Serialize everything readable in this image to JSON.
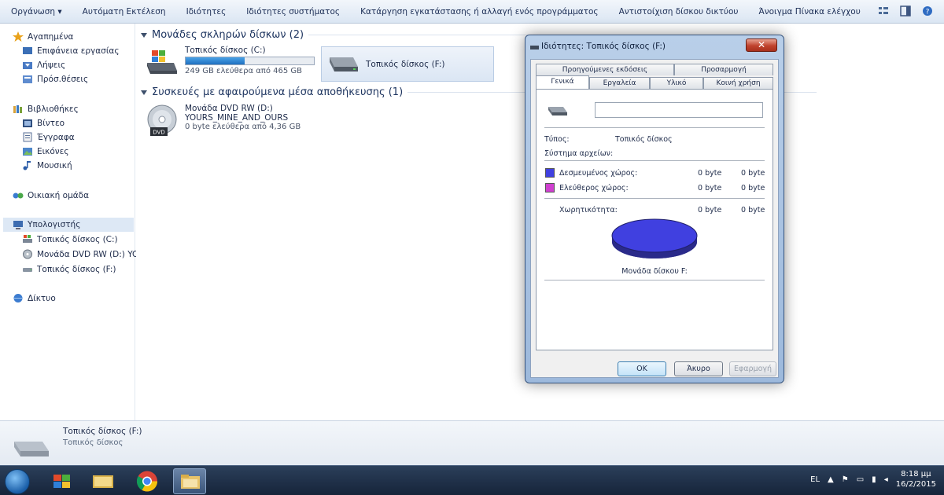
{
  "toolbar": {
    "items": [
      "Οργάνωση ▾",
      "Αυτόματη Εκτέλεση",
      "Ιδιότητες",
      "Ιδιότητες συστήματος",
      "Κατάργηση εγκατάστασης ή αλλαγή ενός προγράμματος",
      "Αντιστοίχιση δίσκου δικτύου",
      "Άνοιγμα Πίνακα ελέγχου"
    ]
  },
  "sidebar": {
    "favorites": "Αγαπημένα",
    "desktop": "Επιφάνεια εργασίας",
    "downloads": "Λήψεις",
    "recent": "Πρόσ.θέσεις",
    "libraries": "Βιβλιοθήκες",
    "video": "Βίντεο",
    "documents": "Έγγραφα",
    "pictures": "Εικόνες",
    "music": "Μουσική",
    "homegroup": "Οικιακή ομάδα",
    "computer": "Υπολογιστής",
    "drive_c": "Τοπικός δίσκος (C:)",
    "drive_d": "Μονάδα DVD RW (D:) YOU",
    "drive_f": "Τοπικός δίσκος (F:)",
    "network": "Δίκτυο"
  },
  "main": {
    "hdd_group": "Μονάδες σκληρών δίσκων (2)",
    "removable_group": "Συσκευές με αφαιρούμενα μέσα αποθήκευσης (1)",
    "drive_c": {
      "name": "Τοπικός δίσκος (C:)",
      "free": "249 GB ελεύθερα από 465 GB",
      "used_fraction": 0.46
    },
    "drive_f": {
      "name": "Τοπικός δίσκος (F:)"
    },
    "dvd": {
      "name": "Μονάδα DVD RW (D:)",
      "label": "YOURS_MINE_AND_OURS",
      "free": "0 byte ελεύθερα από 4,36 GB",
      "icon_text": "DVD"
    }
  },
  "details": {
    "name": "Τοπικός δίσκος (F:)",
    "type": "Τοπικός δίσκος"
  },
  "dialog": {
    "title": "Ιδιότητες: Τοπικός δίσκος (F:)",
    "tabs_back": [
      "Προηγούμενες εκδόσεις",
      "Προσαρμογή"
    ],
    "tabs_front": [
      "Γενικά",
      "Εργαλεία",
      "Υλικό",
      "Κοινή χρήση"
    ],
    "name_value": "",
    "type_label": "Τύπος:",
    "type_value": "Τοπικός δίσκος",
    "fs_label": "Σύστημα αρχείων:",
    "used_label": "Δεσμευμένος χώρος:",
    "used_bytes": "0 byte",
    "used_size": "0 byte",
    "free_label": "Ελεύθερος χώρος:",
    "free_bytes": "0 byte",
    "free_size": "0 byte",
    "capacity_label": "Χωρητικότητα:",
    "capacity_bytes": "0 byte",
    "capacity_size": "0 byte",
    "disk_label": "Μονάδα δίσκου F:",
    "ok": "OK",
    "cancel": "Άκυρο",
    "apply": "Εφαρμογή",
    "used_color": "#4040e0",
    "free_color": "#d040d0"
  },
  "taskbar": {
    "lang": "EL",
    "time": "8:18 μμ",
    "date": "16/2/2015"
  }
}
